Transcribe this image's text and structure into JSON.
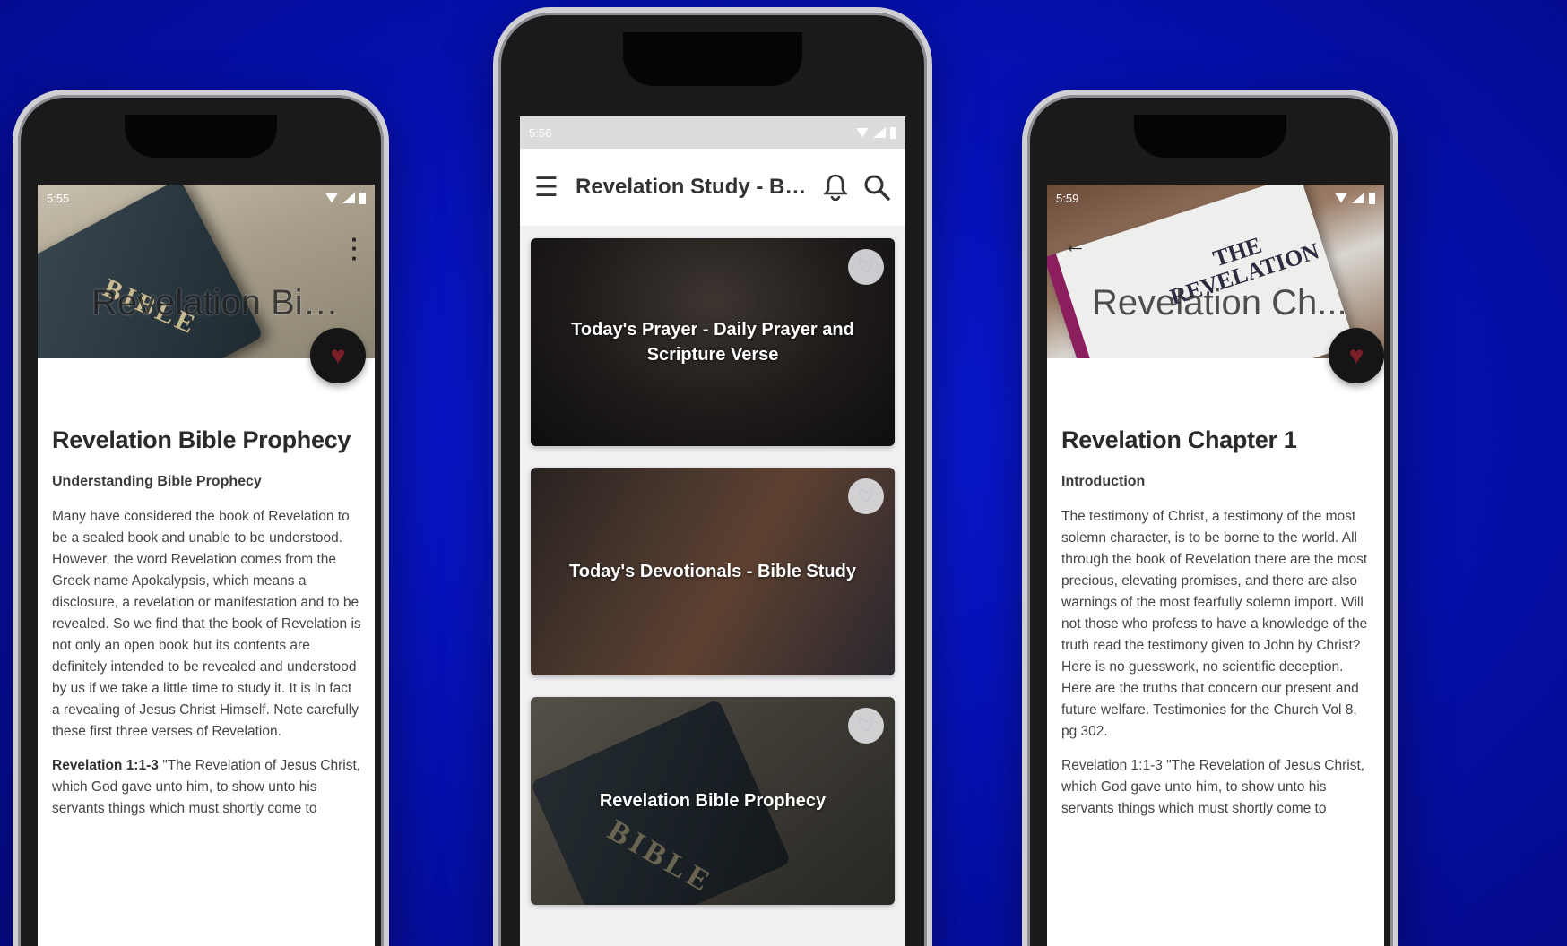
{
  "phones": {
    "left": {
      "status": {
        "time": "5:55"
      },
      "hero": {
        "title": "Revelation Bibl...",
        "book_text": "BIBLE"
      },
      "title": "Revelation Bible Prophecy",
      "subtitle": "Understanding Bible Prophecy",
      "paragraphs": [
        "Many have considered the book of Revelation to be a sealed book and unable to be understood. However, the word Revelation comes from the Greek name Apokalypsis, which means a disclosure, a revelation or manifestation and to be revealed. So we find that the book of Revelation is not only an open book but its contents are definitely intended to be revealed and understood by us if we take a little time to study it. It is in fact a revealing of Jesus Christ Himself. Note carefully these first three verses of Revelation."
      ],
      "verse_ref": "Revelation 1:1-3",
      "verse_text": " \"The Revelation of Jesus Christ, which God gave unto him, to show unto his servants things which must shortly come to"
    },
    "center": {
      "status": {
        "time": "5:56"
      },
      "app_title": "Revelation Study - Bible ...",
      "cards": [
        {
          "title": "Today's Prayer - Daily Prayer and Scripture Verse"
        },
        {
          "title": "Today's Devotionals - Bible Study"
        },
        {
          "title": "Revelation Bible Prophecy",
          "book_text": "BIBLE"
        }
      ]
    },
    "right": {
      "status": {
        "time": "5:59"
      },
      "hero": {
        "title": "Revelation Ch...",
        "book_text": "THE\nREVELATION"
      },
      "title": "Revelation Chapter 1",
      "subtitle": "Introduction",
      "paragraphs": [
        "The testimony of Christ, a testimony of the most solemn character, is to be borne to the world. All through the book of Revelation there are the most precious, elevating promises, and there are also warnings of the most fearfully solemn import. Will not those who profess to have a knowledge of the truth read the testimony given to John by Christ? Here is no guesswork, no scientific deception. Here are the truths that concern our present and future welfare. Testimonies for the Church Vol 8, pg 302."
      ],
      "verse_text": "Revelation 1:1-3 \"The Revelation of Jesus Christ, which God gave unto him, to show unto his servants things which must shortly come to"
    }
  },
  "colors": {
    "background": "#0612b8",
    "fab": "#151515",
    "heart": "#7a1f2a"
  }
}
